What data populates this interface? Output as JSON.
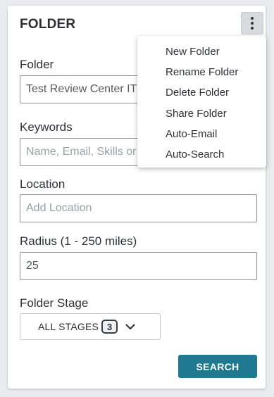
{
  "panel": {
    "title": "FOLDER"
  },
  "fields": {
    "folder": {
      "label": "Folder",
      "value": "Test Review Center IT",
      "placeholder": ""
    },
    "keywords": {
      "label": "Keywords",
      "value": "",
      "placeholder": "Name, Email, Skills or Keywords"
    },
    "location": {
      "label": "Location",
      "value": "",
      "placeholder": "Add Location"
    },
    "radius": {
      "label": "Radius (1 - 250 miles)",
      "value": "25",
      "placeholder": ""
    }
  },
  "stage": {
    "label": "Folder Stage",
    "selected": "ALL STAGES",
    "count": "3"
  },
  "search_button": {
    "label": "SEARCH"
  },
  "menu": {
    "items": [
      {
        "label": "New Folder"
      },
      {
        "label": "Rename Folder"
      },
      {
        "label": "Delete Folder"
      },
      {
        "label": "Share Folder"
      },
      {
        "label": "Auto-Email"
      },
      {
        "label": "Auto-Search"
      }
    ]
  },
  "icons": {
    "menu_toggle": "kebab-icon",
    "dropdown": "chevron-down-icon"
  },
  "colors": {
    "primary": "#1f7a91",
    "panel_background": "#ffffff",
    "page_background": "#e9ebef"
  }
}
